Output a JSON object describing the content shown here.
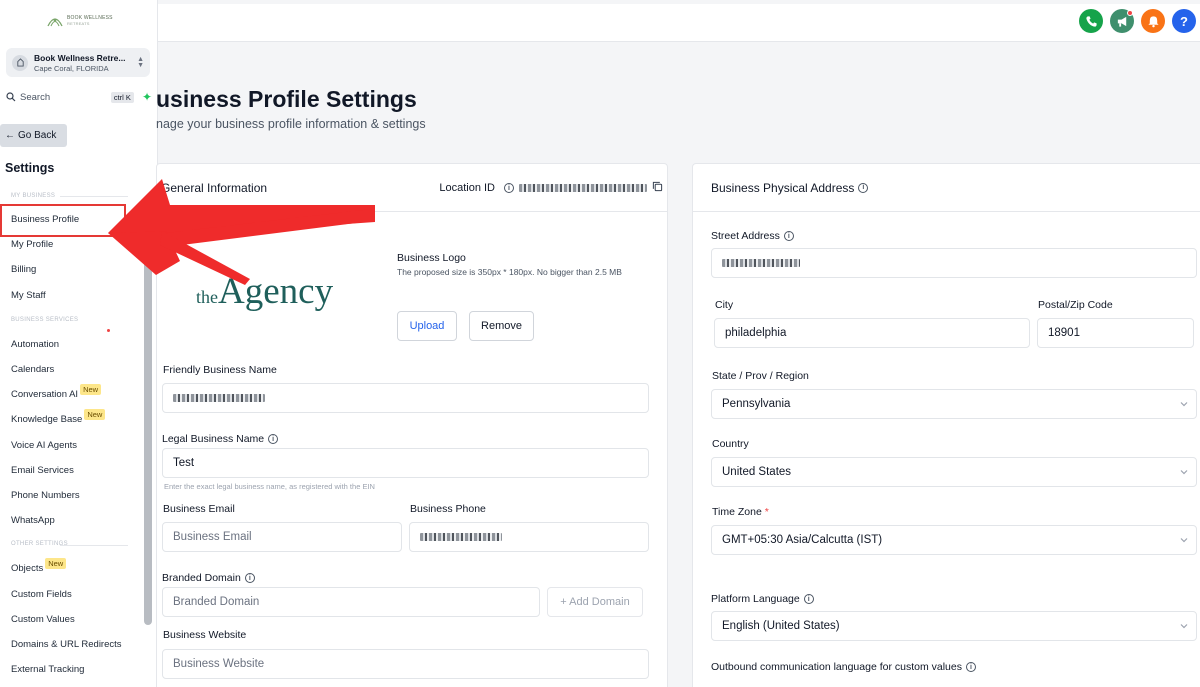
{
  "sidebar": {
    "logo_text_1": "BOOK WELLNESS",
    "logo_text_2": "RETREATS",
    "location_name": "Book Wellness Retre...",
    "location_sub": "Cape Coral, FLORIDA",
    "search_label": "Search",
    "search_shortcut": "ctrl K",
    "go_back": "Go Back",
    "settings_title": "Settings",
    "section_my_business": "MY BUSINESS",
    "section_business_services": "BUSINESS SERVICES",
    "section_other_settings": "OTHER SETTINGS",
    "new_badge": "New",
    "items": {
      "business_profile": "Business Profile",
      "my_profile": "My Profile",
      "billing": "Billing",
      "my_staff": "My Staff",
      "automation": "Automation",
      "calendars": "Calendars",
      "conversation_ai": "Conversation AI",
      "knowledge_base": "Knowledge Base",
      "voice_ai_agents": "Voice AI Agents",
      "email_services": "Email Services",
      "phone_numbers": "Phone Numbers",
      "whatsapp": "WhatsApp",
      "objects": "Objects",
      "custom_fields": "Custom Fields",
      "custom_values": "Custom Values",
      "domains_url_redirects": "Domains & URL Redirects",
      "external_tracking": "External Tracking"
    }
  },
  "topbar": {
    "help_label": "?"
  },
  "page": {
    "title": "usiness Profile Settings",
    "subtitle": "nage your business profile information & settings"
  },
  "general": {
    "title": "General Information",
    "location_id_label": "Location ID",
    "logo_label": "Business Logo",
    "logo_hint": "The proposed size is 350px * 180px. No bigger than 2.5 MB",
    "logo_the": "the",
    "logo_agency": "Agency",
    "upload_button": "Upload",
    "remove_button": "Remove",
    "friendly_name_label": "Friendly Business Name",
    "legal_name_label": "Legal Business Name",
    "legal_name_value": "Test",
    "legal_name_helper": "Enter the exact legal business name, as registered with the EIN",
    "email_label": "Business Email",
    "email_placeholder": "Business Email",
    "phone_label": "Business Phone",
    "domain_label": "Branded Domain",
    "domain_placeholder": "Branded Domain",
    "add_domain_button": "+ Add Domain",
    "website_label": "Business Website",
    "website_placeholder": "Business Website"
  },
  "address": {
    "title": "Business Physical Address",
    "street_label": "Street Address",
    "city_label": "City",
    "city_value": "philadelphia",
    "postal_label": "Postal/Zip Code",
    "postal_value": "18901",
    "state_label": "State / Prov / Region",
    "state_value": "Pennsylvania",
    "country_label": "Country",
    "country_value": "United States",
    "timezone_label": "Time Zone",
    "required_mark": "*",
    "timezone_value": "GMT+05:30 Asia/Calcutta (IST)",
    "platform_language_label": "Platform Language",
    "platform_language_value": "English (United States)",
    "outbound_label": "Outbound communication language for custom values"
  },
  "colors": {
    "phone_btn": "#16a34a",
    "megaphone_btn": "#3f8f6d",
    "bell_btn": "#f97316",
    "help_btn": "#2563eb",
    "highlight": "#e53935",
    "brand_logo": "#1f5f5b"
  },
  "icons": [
    "phone-icon",
    "megaphone-icon",
    "bell-icon",
    "help-icon",
    "search-icon",
    "sparkle-icon",
    "info-icon",
    "copy-icon",
    "chevron-down-icon",
    "arrow-left-icon",
    "location-icon"
  ]
}
